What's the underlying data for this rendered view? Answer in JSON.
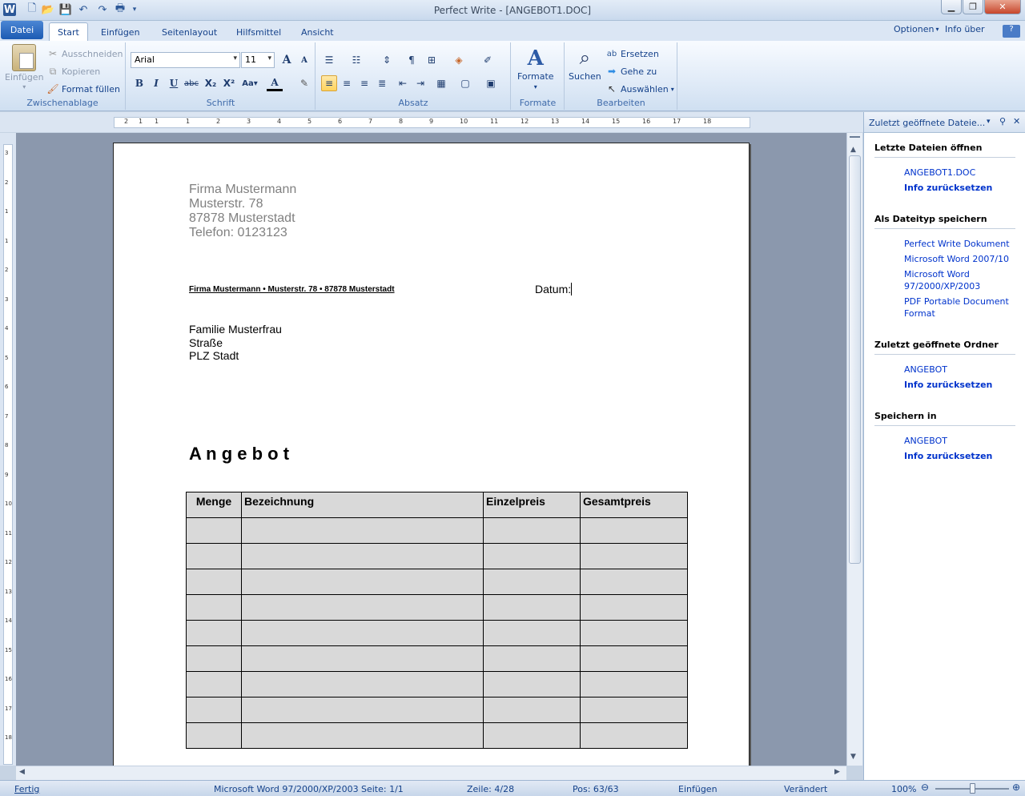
{
  "window": {
    "title": "Perfect Write - [ANGEBOT1.DOC]"
  },
  "tabs": {
    "datei": "Datei",
    "items": [
      "Start",
      "Einfügen",
      "Seitenlayout",
      "Hilfsmittel",
      "Ansicht"
    ],
    "right": [
      "Optionen",
      "Info über"
    ]
  },
  "ribbon": {
    "clipboard": {
      "label": "Zwischenablage",
      "paste": "Einfügen",
      "cut": "Ausschneiden",
      "copy": "Kopieren",
      "format_fill": "Format füllen"
    },
    "font": {
      "label": "Schrift",
      "name": "Arial",
      "size": "11"
    },
    "paragraph": {
      "label": "Absatz"
    },
    "styles": {
      "label": "Formate",
      "button": "Formate"
    },
    "edit": {
      "label": "Bearbeiten",
      "search": "Suchen",
      "replace": "Ersetzen",
      "goto": "Gehe zu",
      "select": "Auswählen"
    }
  },
  "ruler": {
    "h": [
      "2",
      "1",
      "1",
      "1",
      "2",
      "3",
      "4",
      "5",
      "6",
      "7",
      "8",
      "9",
      "10",
      "11",
      "12",
      "13",
      "14",
      "15",
      "16",
      "17",
      "18"
    ],
    "v": [
      "3",
      "2",
      "1",
      "1",
      "2",
      "3",
      "4",
      "5",
      "6",
      "7",
      "8",
      "9",
      "10",
      "11",
      "12",
      "13",
      "14",
      "15",
      "16",
      "17",
      "18"
    ]
  },
  "document": {
    "sender": [
      "Firma Mustermann",
      "Musterstr. 78",
      "87878 Musterstadt",
      "Telefon: 0123123"
    ],
    "return_line": "Firma Mustermann • Musterstr. 78 • 87878 Musterstadt",
    "date_label": "Datum:",
    "recipient": [
      "Familie Musterfrau",
      "Straße",
      "PLZ Stadt"
    ],
    "heading": "A n g e b o t",
    "table": {
      "headers": [
        "Menge",
        "Bezeichnung",
        "Einzelpreis",
        "Gesamtpreis"
      ],
      "empty_rows": 9
    }
  },
  "pane": {
    "title": "Zuletzt geöffnete Dateie...",
    "sections": [
      {
        "title": "Letzte Dateien öffnen",
        "links": [
          {
            "text": "ANGEBOT1.DOC",
            "bold": false
          },
          {
            "text": "Info zurücksetzen",
            "bold": true
          }
        ]
      },
      {
        "title": "Als Dateityp speichern",
        "links": [
          {
            "text": "Perfect Write Dokument",
            "bold": false
          },
          {
            "text": "Microsoft Word 2007/10",
            "bold": false
          },
          {
            "text": "Microsoft Word 97/2000/XP/2003",
            "bold": false
          },
          {
            "text": "PDF Portable Document Format",
            "bold": false
          }
        ]
      },
      {
        "title": "Zuletzt geöffnete Ordner",
        "links": [
          {
            "text": "ANGEBOT",
            "bold": false
          },
          {
            "text": "Info zurücksetzen",
            "bold": true
          }
        ]
      },
      {
        "title": "Speichern in",
        "links": [
          {
            "text": "ANGEBOT",
            "bold": false
          },
          {
            "text": "Info zurücksetzen",
            "bold": true
          }
        ]
      }
    ]
  },
  "status": {
    "ready": "Fertig",
    "format": "Microsoft Word 97/2000/XP/2003",
    "page": "Seite: 1/1",
    "line": "Zeile: 4/28",
    "pos": "Pos: 63/63",
    "mode": "Einfügen",
    "changed": "Verändert",
    "zoom": "100%"
  }
}
